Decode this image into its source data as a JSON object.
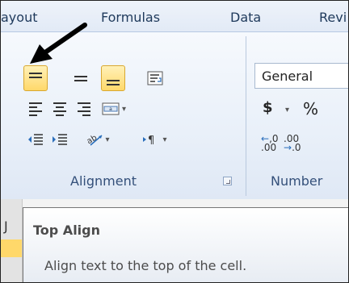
{
  "ribbon": {
    "tabs": [
      "ayout",
      "Formulas",
      "Data",
      "Revi"
    ],
    "alignment": {
      "label": "Alignment",
      "top_align_active": true,
      "bottom_align_active": true
    },
    "number": {
      "label": "Number",
      "format_value": "General",
      "currency_symbol": "$",
      "percent_symbol": "%"
    }
  },
  "sheet": {
    "column_hint": "J"
  },
  "tooltip": {
    "title": "Top Align",
    "description": "Align text to the top of the cell."
  },
  "annotation": {
    "arrow_color": "#000000"
  }
}
